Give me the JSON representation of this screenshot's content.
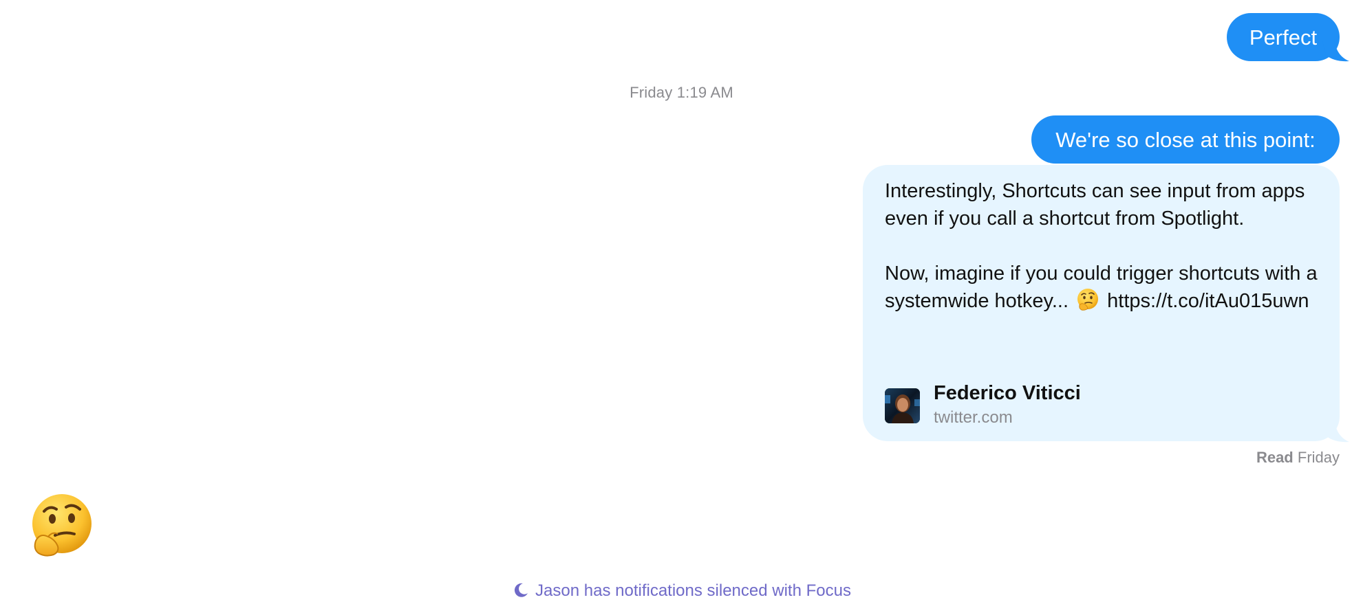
{
  "conversation": {
    "messages": [
      {
        "type": "outgoing",
        "text": "Perfect"
      }
    ],
    "timestamp": "Friday 1:19 AM",
    "after_timestamp": [
      {
        "type": "outgoing",
        "text": "We're so close at this point:"
      }
    ],
    "link_preview": {
      "paragraph_1": "Interestingly, Shortcuts can see input from apps even if you call a shortcut from Spotlight.",
      "paragraph_2_before_emoji": "Now, imagine if you could trigger shortcuts with a systemwide hotkey...",
      "paragraph_2_emoji": "thinking-face-emoji",
      "paragraph_2_after_emoji": "https://t.co/itAu015uwn",
      "source_name": "Federico Viticci",
      "source_domain": "twitter.com"
    },
    "read_receipt": {
      "status": "Read",
      "when": "Friday"
    },
    "incoming_emoji": "thinking-face-emoji",
    "focus_notice": "Jason has notifications silenced with Focus"
  },
  "colors": {
    "outgoing_bubble": "#1f8ff5",
    "link_bubble": "#e6f5ff",
    "meta_text": "#8a8a8e",
    "focus_text": "#6f6ac8"
  }
}
